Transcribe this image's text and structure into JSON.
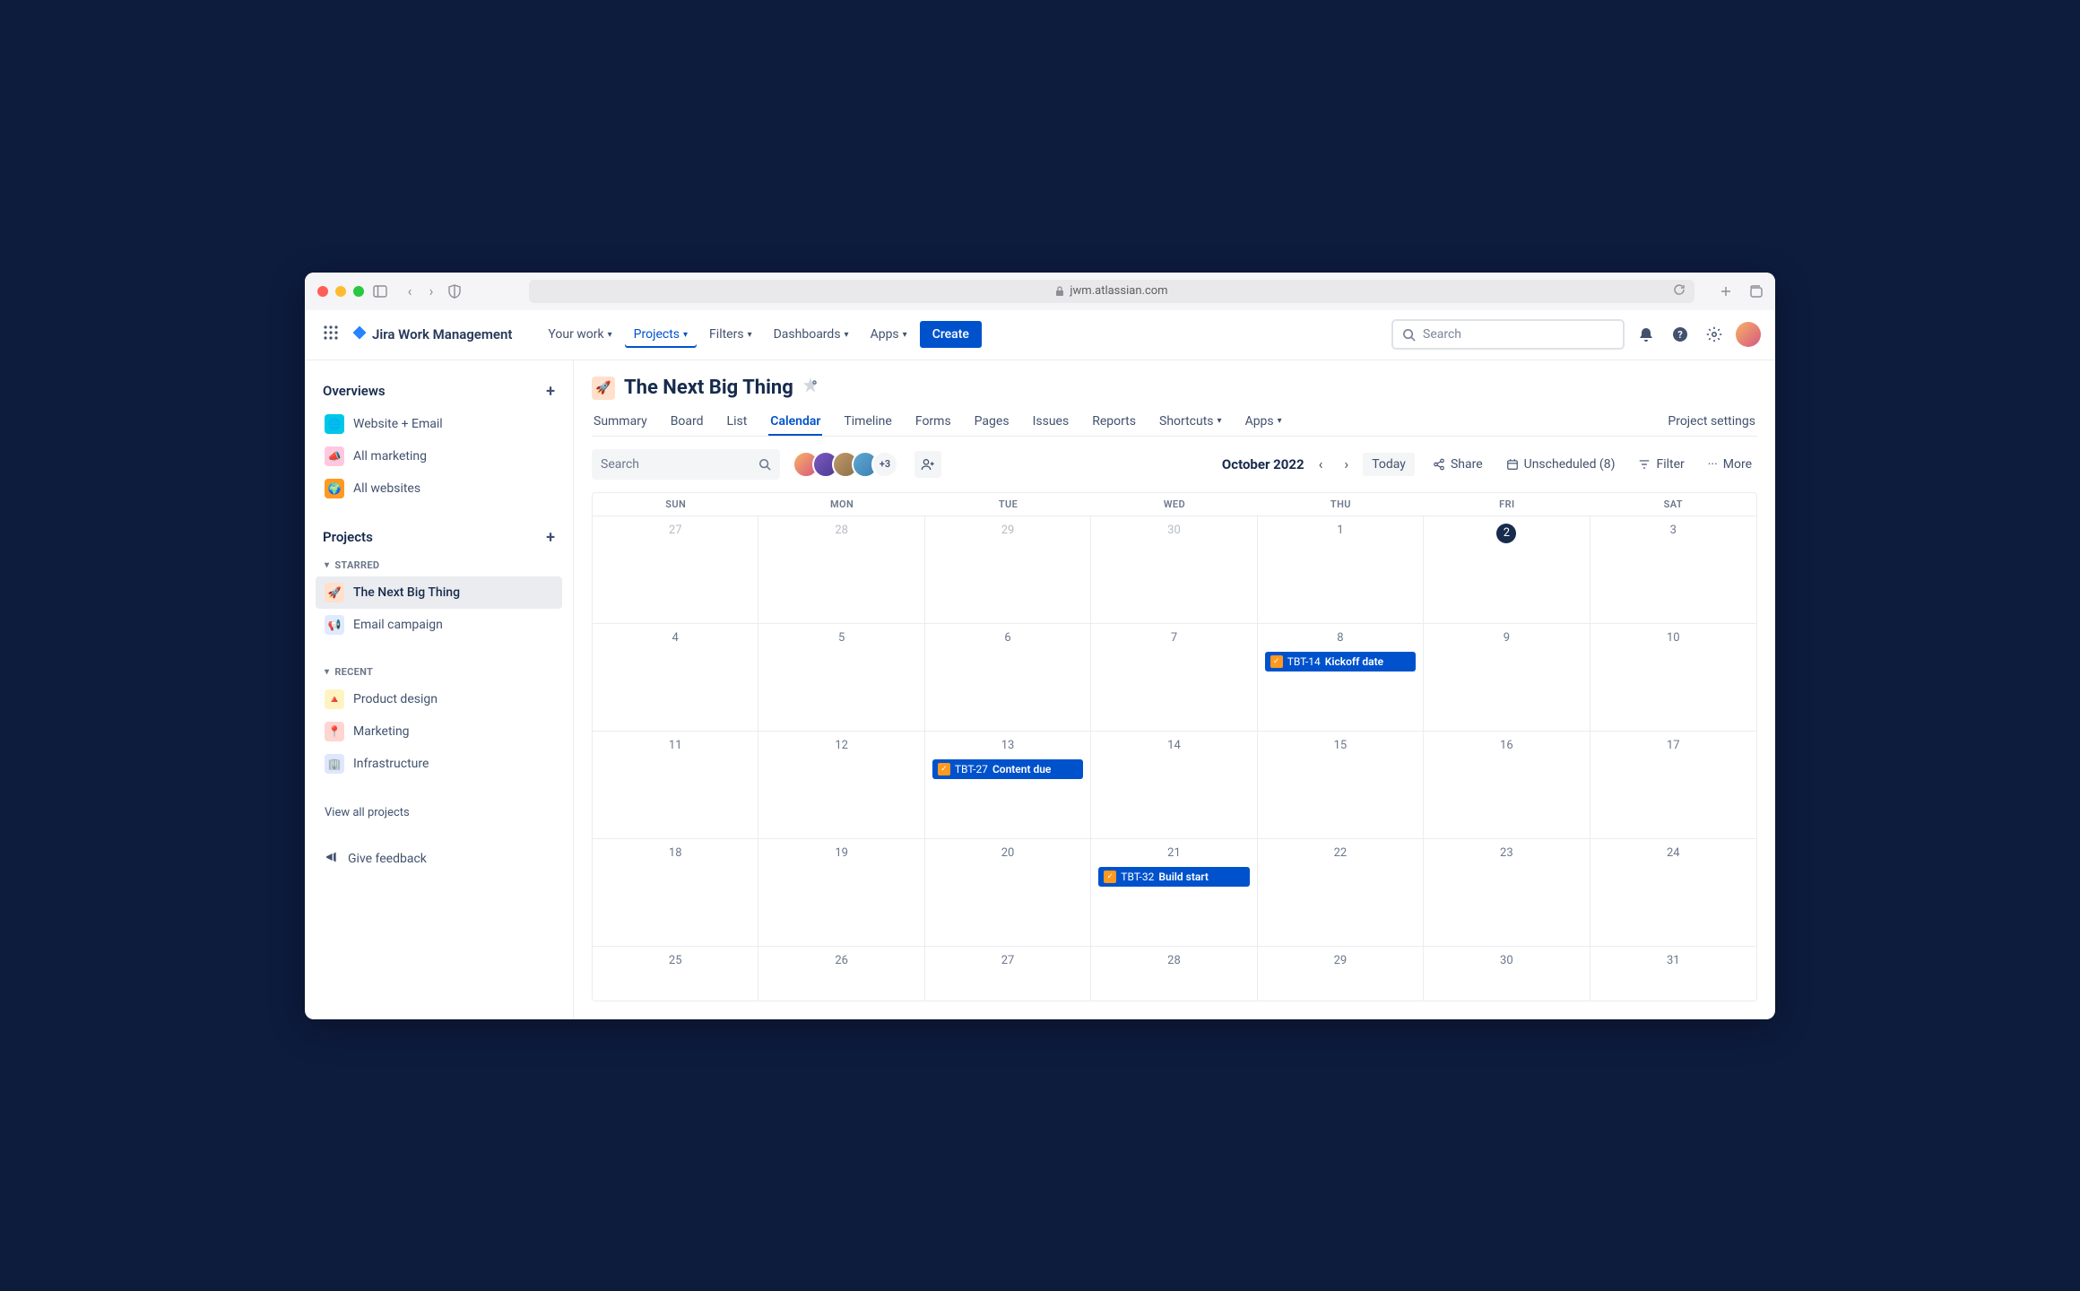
{
  "browser": {
    "url": "jwm.atlassian.com"
  },
  "topnav": {
    "product": "Jira Work Management",
    "items": [
      {
        "label": "Your work"
      },
      {
        "label": "Projects"
      },
      {
        "label": "Filters"
      },
      {
        "label": "Dashboards"
      },
      {
        "label": "Apps"
      }
    ],
    "create_label": "Create",
    "search_placeholder": "Search"
  },
  "sidebar": {
    "overviews_label": "Overviews",
    "overviews": [
      {
        "label": "Website + Email"
      },
      {
        "label": "All marketing"
      },
      {
        "label": "All websites"
      }
    ],
    "projects_label": "Projects",
    "starred_label": "STARRED",
    "starred": [
      {
        "label": "The Next Big Thing"
      },
      {
        "label": "Email campaign"
      }
    ],
    "recent_label": "RECENT",
    "recent": [
      {
        "label": "Product design"
      },
      {
        "label": "Marketing"
      },
      {
        "label": "Infrastructure"
      }
    ],
    "view_all_label": "View all projects",
    "feedback_label": "Give feedback"
  },
  "page": {
    "title": "The Next Big Thing",
    "tabs": [
      {
        "label": "Summary"
      },
      {
        "label": "Board"
      },
      {
        "label": "List"
      },
      {
        "label": "Calendar"
      },
      {
        "label": "Timeline"
      },
      {
        "label": "Forms"
      },
      {
        "label": "Pages"
      },
      {
        "label": "Issues"
      },
      {
        "label": "Reports"
      },
      {
        "label": "Shortcuts"
      },
      {
        "label": "Apps"
      },
      {
        "label": "Project settings"
      }
    ]
  },
  "toolbar": {
    "search_placeholder": "Search",
    "avatars_more": "+3",
    "month_label": "October 2022",
    "today_label": "Today",
    "share_label": "Share",
    "unscheduled_label": "Unscheduled (8)",
    "filter_label": "Filter",
    "more_label": "More"
  },
  "calendar": {
    "day_headers": [
      "SUN",
      "MON",
      "TUE",
      "WED",
      "THU",
      "FRI",
      "SAT"
    ],
    "weeks": [
      [
        {
          "num": "27",
          "other": true
        },
        {
          "num": "28",
          "other": true
        },
        {
          "num": "29",
          "other": true
        },
        {
          "num": "30",
          "other": true
        },
        {
          "num": "1"
        },
        {
          "num": "2",
          "today": true
        },
        {
          "num": "3"
        }
      ],
      [
        {
          "num": "4"
        },
        {
          "num": "5"
        },
        {
          "num": "6"
        },
        {
          "num": "7"
        },
        {
          "num": "8",
          "event": {
            "key": "TBT-14",
            "title": "Kickoff date"
          }
        },
        {
          "num": "9"
        },
        {
          "num": "10"
        }
      ],
      [
        {
          "num": "11"
        },
        {
          "num": "12"
        },
        {
          "num": "13",
          "event": {
            "key": "TBT-27",
            "title": "Content due"
          }
        },
        {
          "num": "14"
        },
        {
          "num": "15"
        },
        {
          "num": "16"
        },
        {
          "num": "17"
        }
      ],
      [
        {
          "num": "18"
        },
        {
          "num": "19"
        },
        {
          "num": "20"
        },
        {
          "num": "21",
          "event": {
            "key": "TBT-32",
            "title": "Build start"
          }
        },
        {
          "num": "22"
        },
        {
          "num": "23"
        },
        {
          "num": "24"
        }
      ],
      [
        {
          "num": "25"
        },
        {
          "num": "26"
        },
        {
          "num": "27"
        },
        {
          "num": "28"
        },
        {
          "num": "29"
        },
        {
          "num": "30"
        },
        {
          "num": "31"
        }
      ]
    ]
  }
}
